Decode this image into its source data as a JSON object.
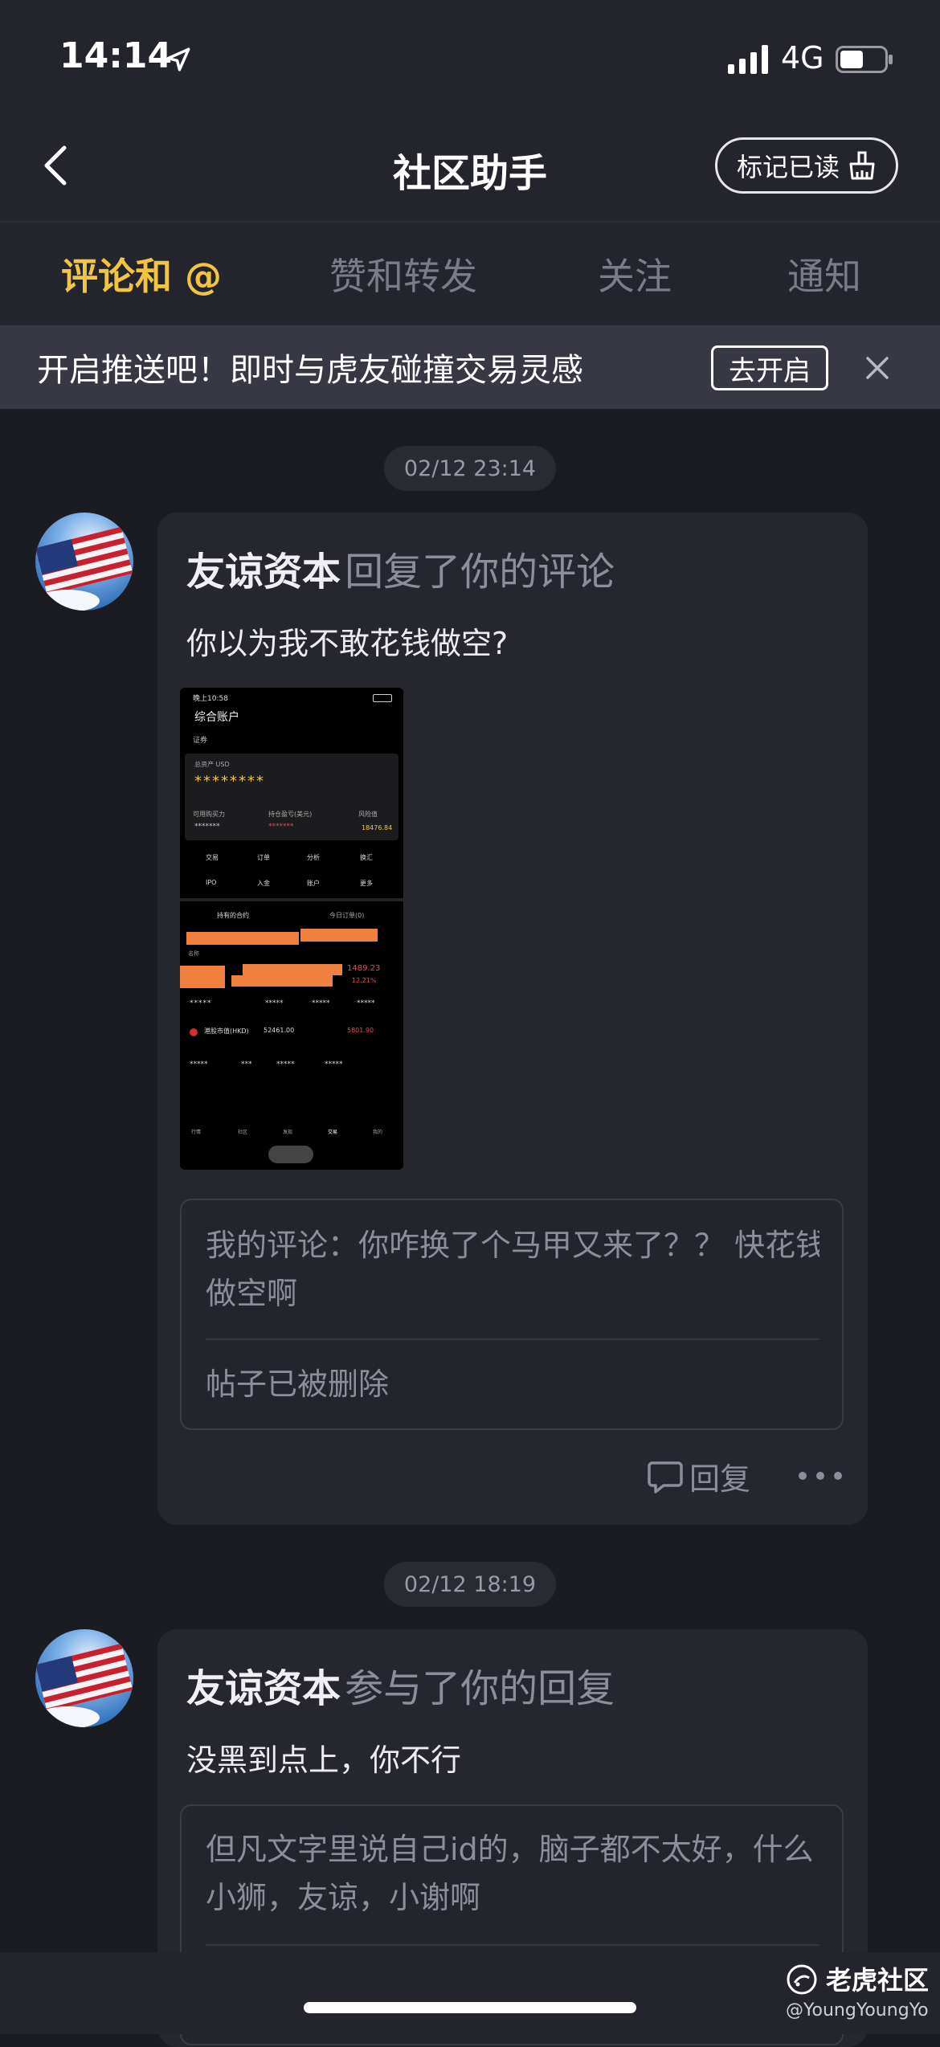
{
  "status_bar": {
    "time": "14:14",
    "network": "4G",
    "location_icon": "location-arrow-icon",
    "signal_icon": "signal-bars-icon",
    "battery_icon": "battery-icon"
  },
  "nav": {
    "title": "社区助手",
    "mark_read": "标记已读",
    "back_icon": "chevron-left-icon",
    "mark_icon": "broom-icon"
  },
  "tabs": [
    {
      "label": "评论和 @",
      "active": true
    },
    {
      "label": "赞和转发",
      "active": false
    },
    {
      "label": "关注",
      "active": false
    },
    {
      "label": "通知",
      "active": false
    }
  ],
  "banner": {
    "text": "开启推送吧！即时与虎友碰撞交易灵感",
    "button": "去开启"
  },
  "colors": {
    "accent": "#f2c443",
    "background": "#1b1b22",
    "card": "#26262f"
  },
  "notifications": [
    {
      "time": "02/12 23:14",
      "author": "友谅资本",
      "action": "回复了你的评论",
      "text": "你以为我不敢花钱做空?",
      "quote_line1": "我的评论：你咋换了个马甲又来了？？ 快花钱",
      "quote_line2": "做空啊",
      "post_status": "帖子已被删除",
      "reply_label": "回复",
      "screenshot": {
        "status_time": "晚上10:58",
        "account_title": "综合账户",
        "tab_securities": "证券",
        "currency": "总资产 USD",
        "masked_total": "********",
        "row_labels": [
          "可用购买力",
          "持仓盈亏(美元)",
          "风险值"
        ],
        "risk_value": "18476.84",
        "menu_row1": [
          "交易",
          "订单",
          "分析",
          "换汇"
        ],
        "menu_row2": [
          "IPO",
          "入金",
          "账户",
          "更多"
        ],
        "position_tabs": [
          "持有的合约",
          "今日订单(0)"
        ],
        "col_label": "名称",
        "pl_value": "1489.23",
        "pl_pct": "12.21%",
        "hk_label": "港股市值(HKD)",
        "hk_value": "52461.00",
        "hk_pl": "5801.90",
        "bottom_nav": [
          "行情",
          "社区",
          "发现",
          "交易",
          "我的"
        ]
      }
    },
    {
      "time": "02/12 18:19",
      "author": "友谅资本",
      "action": "参与了你的回复",
      "text": "没黑到点上，你不行",
      "quote_line1": "但凡文字里说自己id的，脑子都不太好，什么",
      "quote_line2": "小狮，友谅，小谢啊"
    }
  ],
  "watermark": {
    "name": "老虎社区",
    "user": "@YoungYoungYo"
  }
}
